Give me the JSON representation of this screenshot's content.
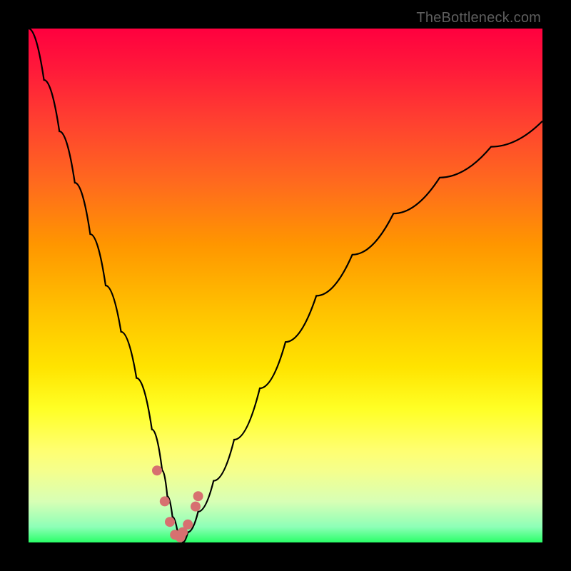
{
  "attribution": "TheBottleneck.com",
  "chart_data": {
    "type": "line",
    "title": "",
    "xlabel": "",
    "ylabel": "",
    "xlim": [
      0,
      100
    ],
    "ylim": [
      0,
      100
    ],
    "note": "Bottleneck-style V-curve; y represents mismatch percentage, x is a normalized component-ratio axis. Values are read off the plotted curve (estimated from pixel positions).",
    "series": [
      {
        "name": "bottleneck-curve",
        "x": [
          0,
          3,
          6,
          9,
          12,
          15,
          18,
          21,
          24,
          26,
          27,
          28,
          29,
          30,
          31,
          33,
          36,
          40,
          45,
          50,
          56,
          63,
          71,
          80,
          90,
          100
        ],
        "y": [
          100,
          90,
          80,
          70,
          60,
          50,
          41,
          32,
          22,
          14,
          9,
          5,
          2,
          0,
          2,
          6,
          12,
          20,
          30,
          39,
          48,
          56,
          64,
          71,
          77,
          82
        ]
      }
    ],
    "markers": {
      "name": "highlight-dots",
      "x": [
        25,
        26.5,
        27.5,
        28.5,
        29.5,
        30,
        31,
        32.5,
        33
      ],
      "y": [
        14,
        8,
        4,
        1.5,
        1,
        2,
        3.5,
        7,
        9
      ]
    },
    "background_gradient": {
      "top": "#ff003f",
      "mid": "#ffe400",
      "bottom": "#2aff68"
    }
  }
}
